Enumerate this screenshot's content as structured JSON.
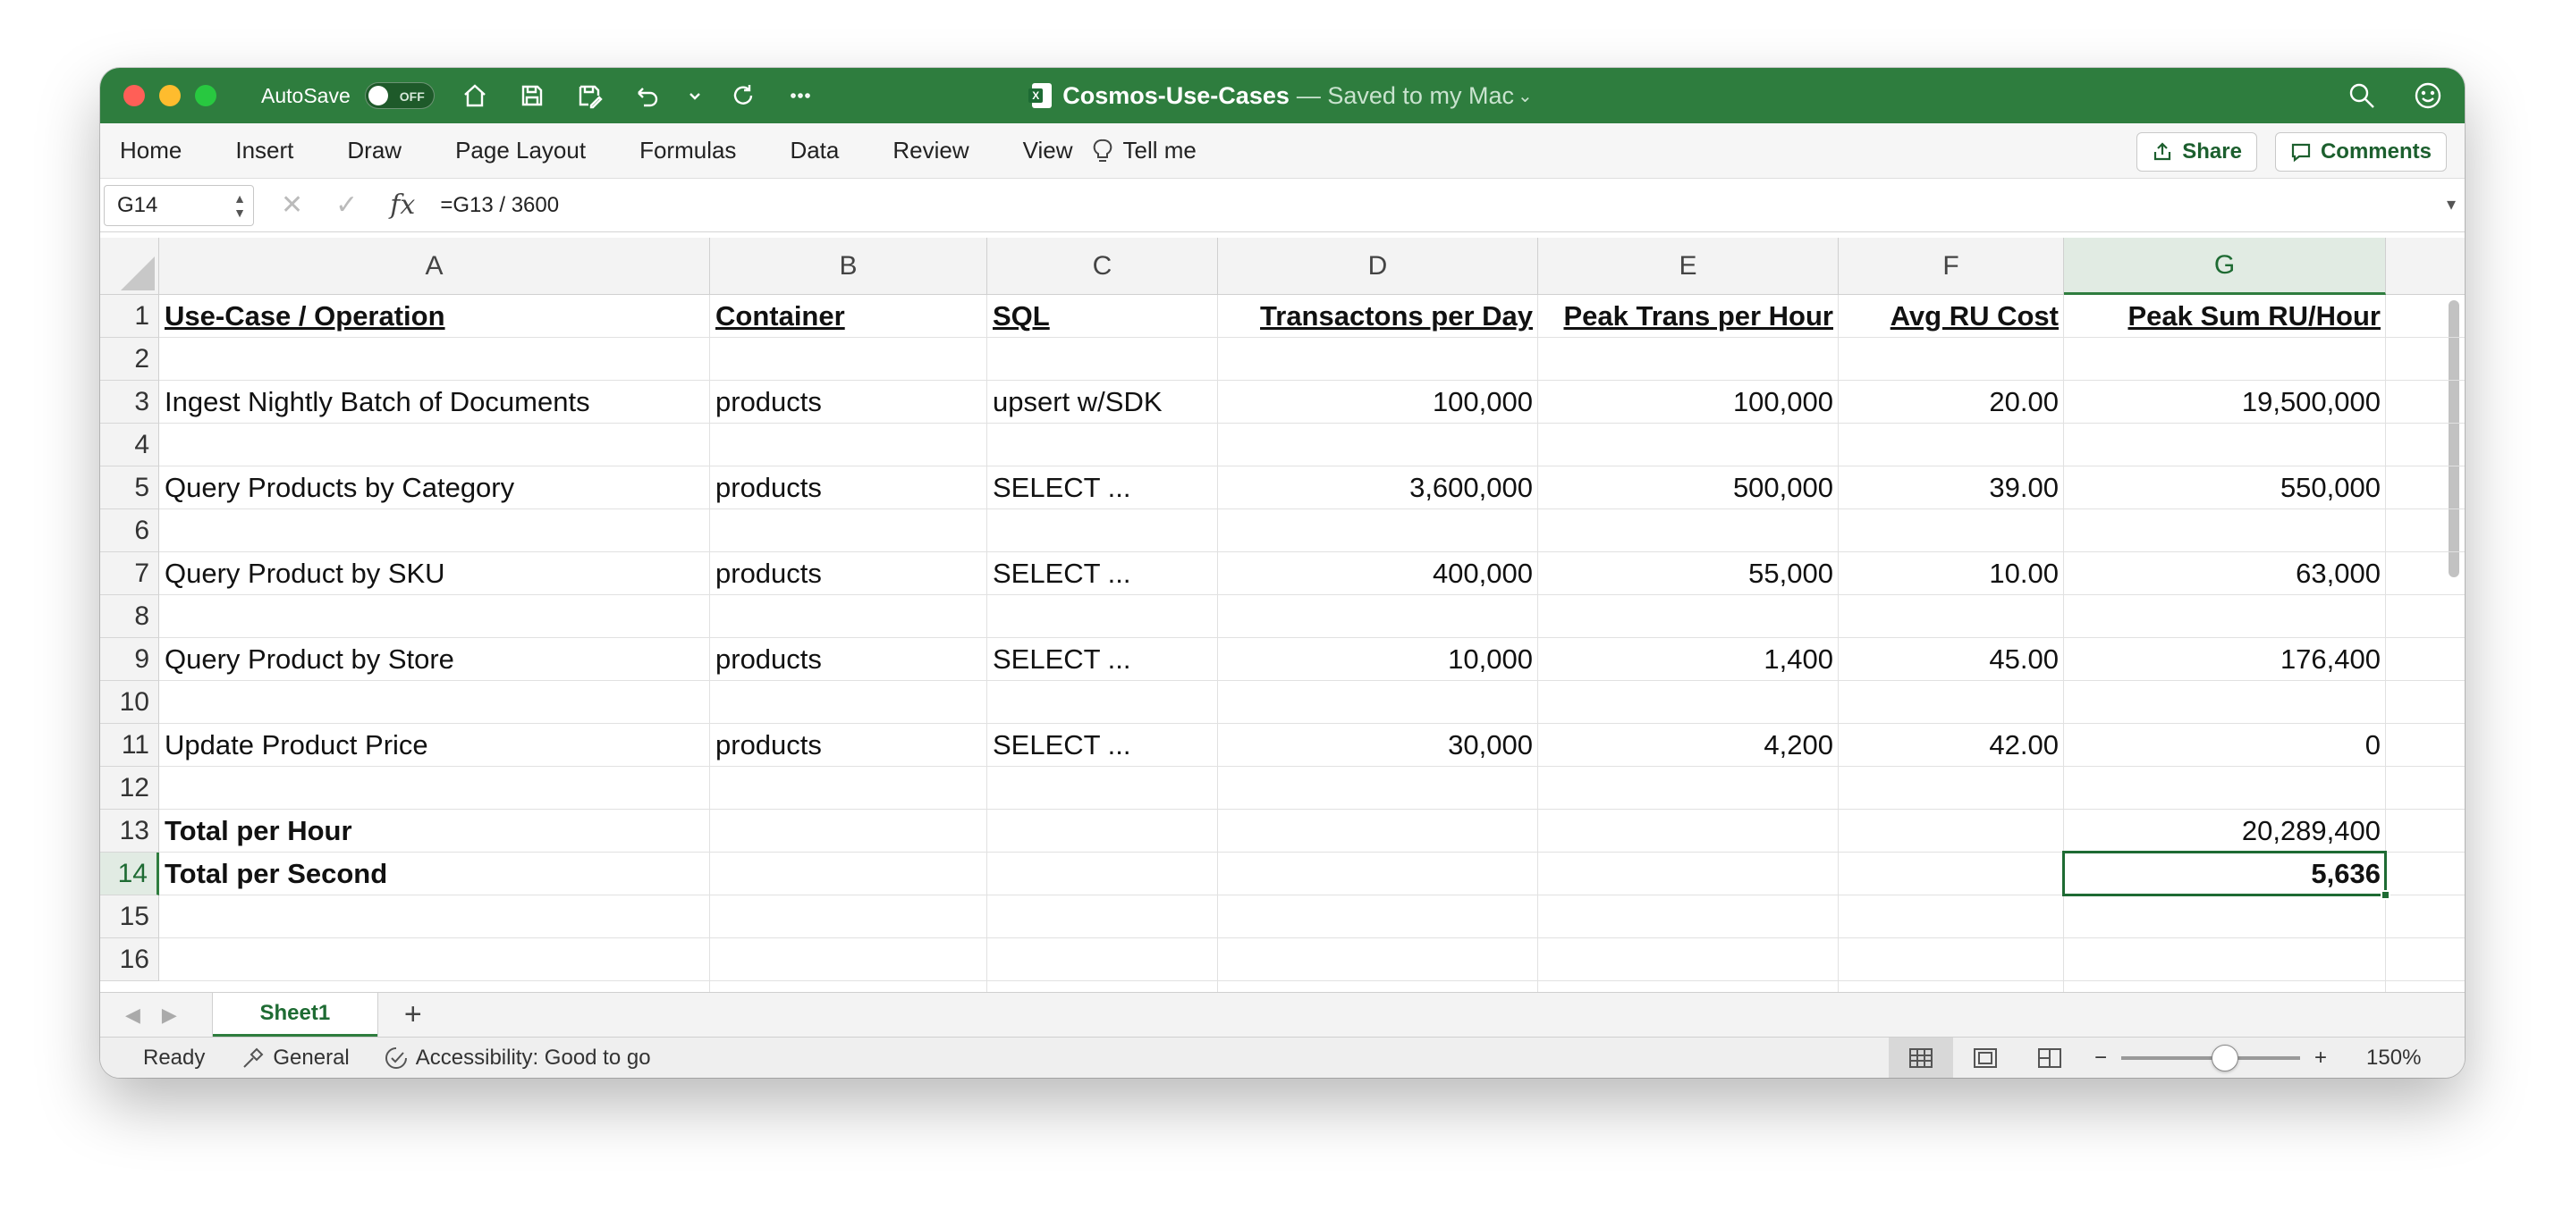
{
  "window": {
    "autosave_label": "AutoSave",
    "autosave_state": "OFF",
    "title": "Cosmos-Use-Cases",
    "title_suffix": "— Saved to my Mac",
    "title_chevron": "⌄"
  },
  "ribbon": {
    "tabs": [
      "Home",
      "Insert",
      "Draw",
      "Page Layout",
      "Formulas",
      "Data",
      "Review",
      "View"
    ],
    "tell_me": "Tell me",
    "share_label": "Share",
    "comments_label": "Comments"
  },
  "formula_bar": {
    "name_box": "G14",
    "formula": "=G13 / 3600",
    "fx": "fx",
    "cancel": "✕",
    "enter": "✓",
    "arrows": "▲\n▼",
    "expand": "▾"
  },
  "grid": {
    "columns": [
      "A",
      "B",
      "C",
      "D",
      "E",
      "F",
      "G"
    ],
    "selected_column": "G",
    "rows": [
      "1",
      "2",
      "3",
      "4",
      "5",
      "6",
      "7",
      "8",
      "9",
      "10",
      "11",
      "12",
      "13",
      "14",
      "15",
      "16"
    ],
    "selected_row": "14",
    "headers": {
      "A": "Use-Case / Operation",
      "B": "Container",
      "C": "SQL",
      "D": "Transactons per Day",
      "E": "Peak Trans per Hour",
      "F": "Avg RU Cost",
      "G": "Peak Sum RU/Hour"
    },
    "data_rows": [
      {
        "row": 3,
        "A": "Ingest Nightly Batch of Documents",
        "B": "products",
        "C": "upsert w/SDK",
        "D": "100,000",
        "E": "100,000",
        "F": "20.00",
        "G": "19,500,000"
      },
      {
        "row": 5,
        "A": "Query Products by Category",
        "B": "products",
        "C": "SELECT ...",
        "D": "3,600,000",
        "E": "500,000",
        "F": "39.00",
        "G": "550,000"
      },
      {
        "row": 7,
        "A": "Query Product by SKU",
        "B": "products",
        "C": "SELECT ...",
        "D": "400,000",
        "E": "55,000",
        "F": "10.00",
        "G": "63,000"
      },
      {
        "row": 9,
        "A": "Query Product by Store",
        "B": "products",
        "C": "SELECT ...",
        "D": "10,000",
        "E": "1,400",
        "F": "45.00",
        "G": "176,400"
      },
      {
        "row": 11,
        "A": "Update Product Price",
        "B": "products",
        "C": "SELECT ...",
        "D": "30,000",
        "E": "4,200",
        "F": "42.00",
        "G": "0"
      }
    ],
    "totals": {
      "per_hour_label": "Total per Hour",
      "per_hour_value": "20,289,400",
      "per_second_label": "Total per Second",
      "per_second_value": "5,636"
    }
  },
  "sheets": {
    "tabs": [
      "Sheet1"
    ],
    "add": "+",
    "prev": "◀",
    "next": "▶"
  },
  "status": {
    "ready": "Ready",
    "format": "General",
    "accessibility": "Accessibility: Good to go",
    "zoom_out": "−",
    "zoom_in": "+",
    "zoom_level": "150%",
    "zoom_fraction": 0.58
  },
  "colors": {
    "accent": "#2e7d3e",
    "selection": "#1e6b33"
  }
}
